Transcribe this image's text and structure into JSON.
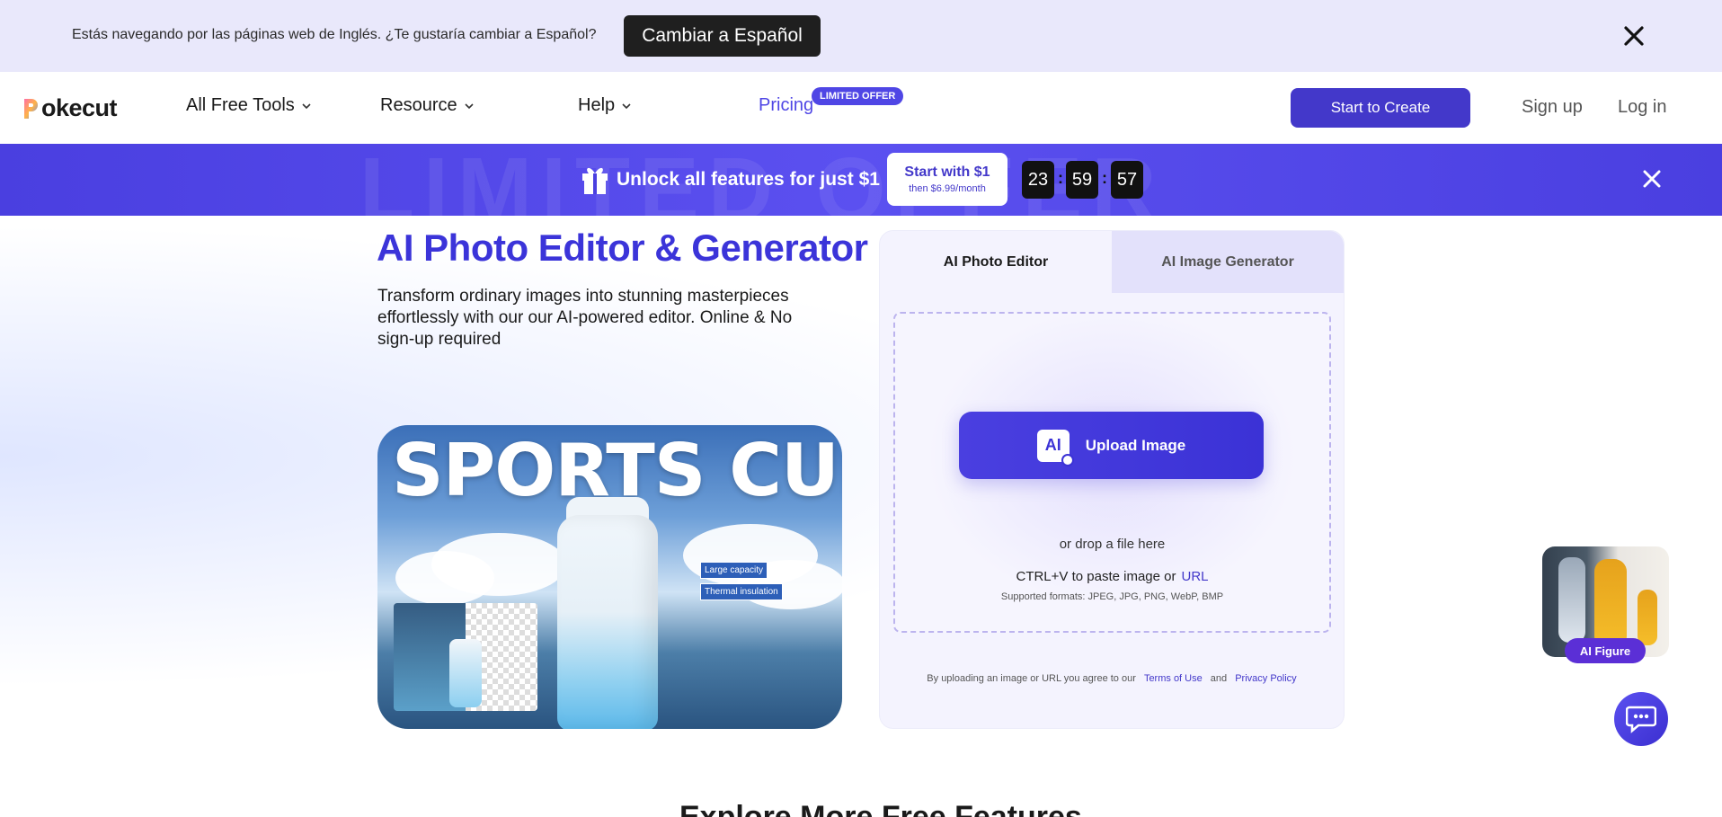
{
  "lang_bar": {
    "message": "Estás navegando por las páginas web de Inglés. ¿Te gustaría cambiar a Español?",
    "switch_label": "Cambiar a Español"
  },
  "header": {
    "logo_text": "okecut",
    "nav": {
      "tools": "All Free Tools",
      "resource": "Resource",
      "help": "Help",
      "pricing": "Pricing",
      "pricing_badge": "LIMITED OFFER"
    },
    "start_label": "Start to Create",
    "signup_label": "Sign up",
    "login_label": "Log in"
  },
  "promo": {
    "watermark": "LIMITED OFFER",
    "text": "Unlock all features for just $1",
    "cta_main": "Start with $1",
    "cta_sub": "then $6.99/month",
    "timer": {
      "hours": "23",
      "minutes": "59",
      "seconds": "57"
    },
    "separator": ":"
  },
  "hero": {
    "title": "AI Photo Editor & Generator",
    "description": "Transform ordinary images into stunning masterpieces effortlessly with our our AI-powered editor. Online & No sign-up required",
    "image_title": "SPORTS CUP",
    "tag_1": "Large capacity",
    "tag_2": "Thermal insulation"
  },
  "upload": {
    "tabs": {
      "editor": "AI Photo Editor",
      "generator": "AI Image Generator"
    },
    "button_icon_text": "AI",
    "button_label": "Upload Image",
    "drop_text": "or drop a file here",
    "paste_text": "CTRL+V to paste image or",
    "url_label": "URL",
    "formats": "Supported formats: JPEG, JPG, PNG, WebP, BMP",
    "terms_prefix": "By uploading an image or URL you agree to our",
    "terms_link": "Terms of Use",
    "and": "and",
    "privacy_link": "Privacy Policy"
  },
  "floating": {
    "ai_figure_label": "AI Figure"
  },
  "section": {
    "explore_title": "Explore More Free Features"
  },
  "colors": {
    "brand": "#4338ca",
    "title_blue": "#3b34d9",
    "lang_bar_bg": "#e9e8fb",
    "promo_bg": "#4a3fe0"
  }
}
